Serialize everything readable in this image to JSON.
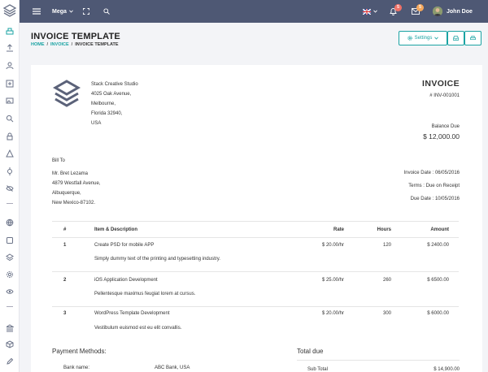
{
  "topbar": {
    "mega_label": "Mega",
    "notifications_count": "5",
    "messages_count": "5",
    "user_name": "John Doe",
    "accent": "#4e5874"
  },
  "header": {
    "title": "INVOICE TEMPLATE",
    "breadcrumbs": [
      "HOME",
      "INVOICE",
      "INVOICE TEMPLATE"
    ],
    "settings_label": "Settings"
  },
  "company": {
    "name": "Stack Creative Studio",
    "street": "4025 Oak Avenue,",
    "city": "Melbourne,",
    "state_zip": "Florida 32940,",
    "country": "USA"
  },
  "invoice": {
    "title": "INVOICE",
    "number": "# INV-001001",
    "balance_label": "Balance Due",
    "balance_amount": "$ 12,000.00"
  },
  "bill_to": {
    "label": "Bill To",
    "name": "Mr. Bret Lezama",
    "street": "4879 Westfall Avenue,",
    "city": "Albuquerque,",
    "state_zip": "New Mexico-87102."
  },
  "dates": {
    "invoice_date": "Invoice Date : 06/05/2016",
    "terms": "Terms : Due on Receipt",
    "due_date": "Due Date : 10/05/2016"
  },
  "table": {
    "headers": [
      "#",
      "Item & Description",
      "Rate",
      "Hours",
      "Amount"
    ],
    "rows": [
      {
        "num": "1",
        "item": "Create PSD for mobile APP",
        "desc": "Simply dummy text of the printing and typesetting industry.",
        "rate": "$ 20.00/hr",
        "hours": "120",
        "amount": "$ 2400.00"
      },
      {
        "num": "2",
        "item": "iOS Application Development",
        "desc": "Pellentesque maximus feugiat lorem at cursus.",
        "rate": "$ 25.00/hr",
        "hours": "260",
        "amount": "$ 6500.00"
      },
      {
        "num": "3",
        "item": "WordPress Template Development",
        "desc": "Vestibulum euismod est eu elit convallis.",
        "rate": "$ 20.00/hr",
        "hours": "300",
        "amount": "$ 6000.00"
      }
    ]
  },
  "payment": {
    "label": "Payment Methods:",
    "bank_name_label": "Bank name:",
    "bank_name_value": "ABC Bank, USA"
  },
  "totals": {
    "label": "Total due",
    "subtotal_label": "Sub Total",
    "subtotal_value": "$ 14,900.00"
  }
}
